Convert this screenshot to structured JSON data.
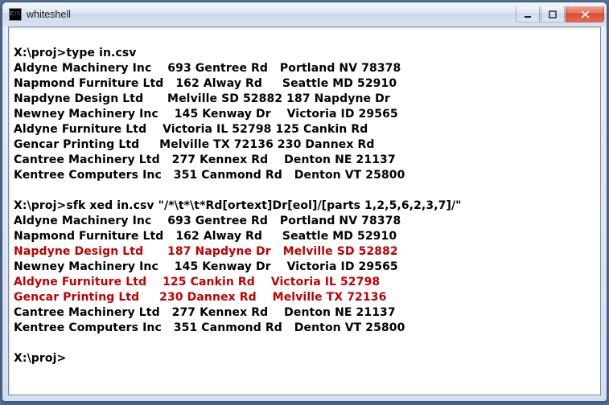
{
  "window": {
    "title": "whiteshell",
    "icon_label": "C:\\"
  },
  "prompt": "X:\\proj>",
  "commands": {
    "cmd1": "type in.csv",
    "cmd2": "sfk xed in.csv \"/*\\t*\\t*Rd[ortext]Dr[eol]/[parts 1,2,5,6,2,3,7]/\""
  },
  "block1": [
    {
      "c1": "Aldyne Machinery Inc",
      "c2": "693 Gentree Rd",
      "c3": "Portland NV 78378",
      "hl": false
    },
    {
      "c1": "Napmond Furniture Ltd",
      "c2": "162 Alway Rd",
      "c3": "Seattle MD 52910",
      "hl": false
    },
    {
      "c1": "Napdyne Design Ltd",
      "c2": "Melville SD 52882",
      "c3": "187 Napdyne Dr",
      "hl": false
    },
    {
      "c1": "Newney Machinery Inc",
      "c2": "145 Kenway Dr",
      "c3": "Victoria ID 29565",
      "hl": false
    },
    {
      "c1": "Aldyne Furniture Ltd",
      "c2": "Victoria IL 52798",
      "c3": "125 Cankin Rd",
      "hl": false
    },
    {
      "c1": "Gencar Printing Ltd",
      "c2": "Melville TX 72136",
      "c3": "230 Dannex Rd",
      "hl": false
    },
    {
      "c1": "Cantree Machinery Ltd",
      "c2": "277 Kennex Rd",
      "c3": "Denton NE 21137",
      "hl": false
    },
    {
      "c1": "Kentree Computers Inc",
      "c2": "351 Canmond Rd",
      "c3": "Denton VT 25800",
      "hl": false
    }
  ],
  "block2": [
    {
      "c1": "Aldyne Machinery Inc",
      "c2": "693 Gentree Rd",
      "c3": "Portland NV 78378",
      "hl": false
    },
    {
      "c1": "Napmond Furniture Ltd",
      "c2": "162 Alway Rd",
      "c3": "Seattle MD 52910",
      "hl": false
    },
    {
      "c1": "Napdyne Design Ltd",
      "c2": "187 Napdyne Dr",
      "c3": "Melville SD 52882",
      "hl": true
    },
    {
      "c1": "Newney Machinery Inc",
      "c2": "145 Kenway Dr",
      "c3": "Victoria ID 29565",
      "hl": false
    },
    {
      "c1": "Aldyne Furniture Ltd",
      "c2": "125 Cankin Rd",
      "c3": "Victoria IL 52798",
      "hl": true
    },
    {
      "c1": "Gencar Printing Ltd",
      "c2": "230 Dannex Rd",
      "c3": "Melville TX 72136",
      "hl": true
    },
    {
      "c1": "Cantree Machinery Ltd",
      "c2": "277 Kennex Rd",
      "c3": "Denton NE 21137",
      "hl": false
    },
    {
      "c1": "Kentree Computers Inc",
      "c2": "351 Canmond Rd",
      "c3": "Denton VT 25800",
      "hl": false
    }
  ],
  "layout": {
    "col1_width": 24,
    "col2_width": 17,
    "b1_special_col2_width": 25
  }
}
